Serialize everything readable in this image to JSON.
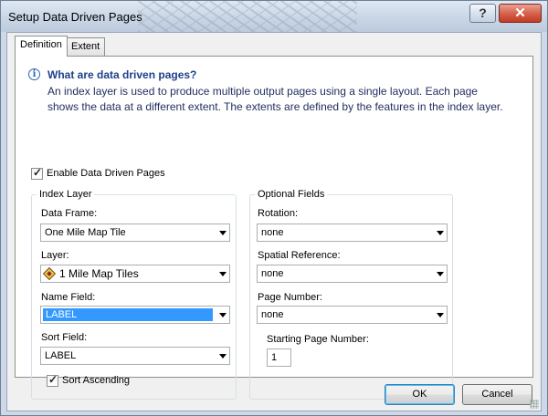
{
  "window": {
    "title": "Setup Data Driven Pages",
    "help_label": "?",
    "close_label": "✕"
  },
  "tabs": [
    {
      "label": "Definition"
    },
    {
      "label": "Extent"
    }
  ],
  "info": {
    "icon": "info-icon",
    "heading": "What are data driven pages?",
    "text": "An index layer is used to produce multiple output pages using a single layout.  Each page shows the data at a different extent.  The extents are defined by the features in the index layer."
  },
  "enable_ddp": {
    "label": "Enable Data Driven Pages",
    "checked": true
  },
  "index_layer": {
    "title": "Index Layer",
    "data_frame": {
      "label": "Data Frame:",
      "value": "One Mile Map Tile"
    },
    "layer": {
      "label": "Layer:",
      "value": "1 Mile Map Tiles"
    },
    "name_field": {
      "label": "Name Field:",
      "value": "LABEL"
    },
    "sort_field": {
      "label": "Sort Field:",
      "value": "LABEL"
    },
    "sort_ascending": {
      "label": "Sort Ascending",
      "checked": true
    }
  },
  "optional_fields": {
    "title": "Optional Fields",
    "rotation": {
      "label": "Rotation:",
      "value": "none"
    },
    "spatial_reference": {
      "label": "Spatial Reference:",
      "value": "none"
    },
    "page_number": {
      "label": "Page Number:",
      "value": "none"
    },
    "starting_page_number": {
      "label": "Starting Page Number:",
      "value": "1"
    }
  },
  "buttons": {
    "ok": "OK",
    "cancel": "Cancel"
  }
}
